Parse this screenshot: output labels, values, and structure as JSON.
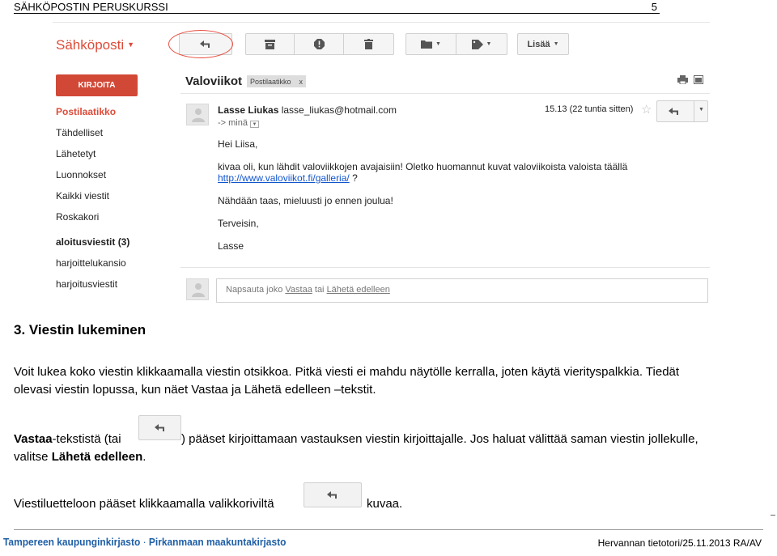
{
  "header": {
    "title": "SÄHKÖPOSTIN PERUSKURSSI",
    "page_number": "5"
  },
  "gmail": {
    "logo": "Sähköposti",
    "toolbar": {
      "more_label": "Lisää"
    },
    "compose_label": "KIRJOITA",
    "nav": [
      {
        "label": "Postilaatikko",
        "state": "active"
      },
      {
        "label": "Tähdelliset",
        "state": ""
      },
      {
        "label": "Lähetetyt",
        "state": ""
      },
      {
        "label": "Luonnokset",
        "state": ""
      },
      {
        "label": "Kaikki viestit",
        "state": ""
      },
      {
        "label": "Roskakori",
        "state": ""
      },
      {
        "label": "aloitusviestit (3)",
        "state": "bold"
      },
      {
        "label": "harjoittelukansio",
        "state": ""
      },
      {
        "label": "harjoitusviestit",
        "state": ""
      }
    ],
    "subject": "Valoviikot",
    "label_chip": "Postilaatikko",
    "label_chip_close": "x",
    "sender_name": "Lasse Liukas",
    "sender_email": "lasse_liukas@hotmail.com",
    "to": "-> minä",
    "time": "15.13 (22 tuntia sitten)",
    "body": {
      "greeting": "Hei Liisa,",
      "line1": "kivaa oli, kun lähdit valoviikkojen avajaisiin! Oletko huomannut kuvat valoviikoista valoista täällä",
      "link": "http://www.valoviikot.fi/galleria/",
      "link_suffix": " ?",
      "line3": "Nähdään taas, mieluusti jo ennen joulua!",
      "closing": "Terveisin,",
      "signature": "Lasse"
    },
    "reply_box": {
      "prefix": "Napsauta joko ",
      "reply": "Vastaa",
      "middle": " tai ",
      "forward": "Lähetä edelleen"
    }
  },
  "content": {
    "heading": "3. Viestin lukeminen",
    "para1_line1": "Voit lukea koko viestin klikkaamalla viestin otsikkoa. Pitkä viesti ei mahdu näytölle kerralla, joten käytä vierityspalkkia. Tiedät",
    "para1_line2": "olevasi viestin lopussa, kun näet Vastaa ja Lähetä edelleen –tekstit.",
    "para2_bold1": "Vastaa",
    "para2_a": "-tekstistä (tai",
    "para2_b": ") pääset kirjoittamaan vastauksen viestin kirjoittajalle. Jos haluat välittää saman viestin jollekulle,",
    "para2_c": "valitse ",
    "para2_bold2": "Lähetä edelleen",
    "para2_d": ".",
    "para3_a": "Viestiluetteloon pääset klikkaamalla valikkoriviltä",
    "para3_b": "kuvaa."
  },
  "footer": {
    "logo_left": "Tampereen kaupunginkirjasto",
    "logo_sep": " · ",
    "logo_right": "Pirkanmaan maakuntakirjasto",
    "right": "Hervannan tietotori/25.11.2013 RA/AV"
  },
  "colors": {
    "accent_red": "#dd4b39",
    "compose_red": "#d14836",
    "link_blue": "#1155cc",
    "footer_blue": "#1f5fa6"
  }
}
